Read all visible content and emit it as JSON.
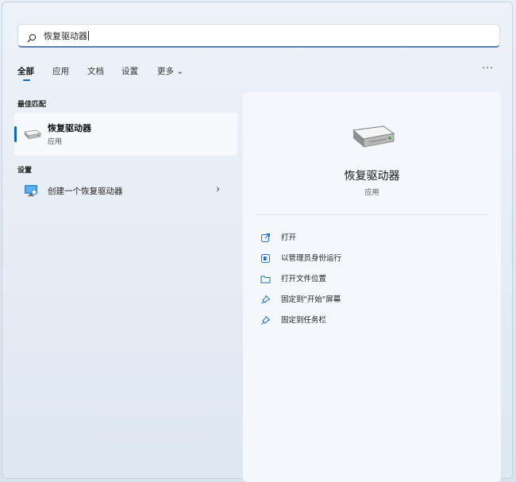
{
  "search": {
    "query": "恢复驱动器"
  },
  "tabs": [
    {
      "label": "全部",
      "active": true
    },
    {
      "label": "应用"
    },
    {
      "label": "文档"
    },
    {
      "label": "设置"
    },
    {
      "label": "更多 ⌄"
    }
  ],
  "more_options": "···",
  "best_match": {
    "section_label": "最佳匹配",
    "title": "恢复驱动器",
    "subtitle": "应用",
    "icon": "drive-icon"
  },
  "settings": {
    "section_label": "设置",
    "item_label": "创建一个恢复驱动器",
    "chevron": "›",
    "icon": "recovery-settings-icon"
  },
  "detail": {
    "title": "恢复驱动器",
    "subtitle": "应用",
    "actions": [
      {
        "label": "打开",
        "icon": "open-icon"
      },
      {
        "label": "以管理员身份运行",
        "icon": "shield-icon"
      },
      {
        "label": "打开文件位置",
        "icon": "folder-icon"
      },
      {
        "label": "固定到\"开始\"屏幕",
        "icon": "pin-icon"
      },
      {
        "label": "固定到任务栏",
        "icon": "pin-icon"
      }
    ]
  },
  "colors": {
    "accent": "#0f63c4"
  }
}
